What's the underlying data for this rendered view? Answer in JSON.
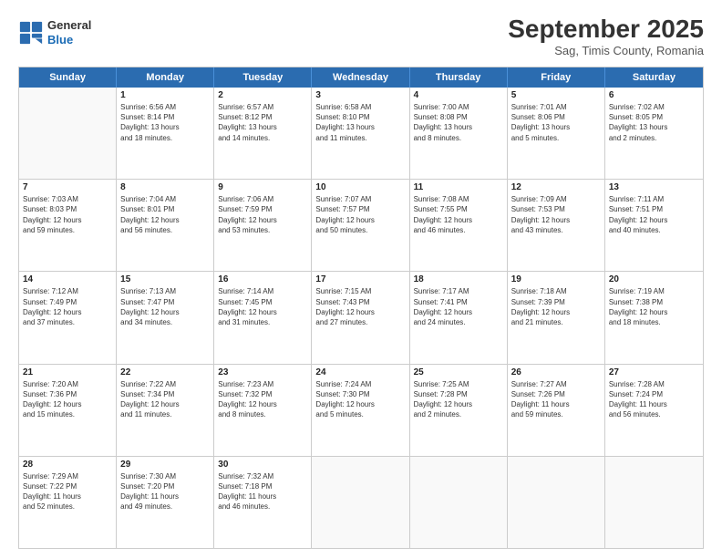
{
  "header": {
    "logo_general": "General",
    "logo_blue": "Blue",
    "month_title": "September 2025",
    "subtitle": "Sag, Timis County, Romania"
  },
  "days": [
    "Sunday",
    "Monday",
    "Tuesday",
    "Wednesday",
    "Thursday",
    "Friday",
    "Saturday"
  ],
  "rows": [
    [
      {
        "day": "",
        "info": ""
      },
      {
        "day": "1",
        "info": "Sunrise: 6:56 AM\nSunset: 8:14 PM\nDaylight: 13 hours\nand 18 minutes."
      },
      {
        "day": "2",
        "info": "Sunrise: 6:57 AM\nSunset: 8:12 PM\nDaylight: 13 hours\nand 14 minutes."
      },
      {
        "day": "3",
        "info": "Sunrise: 6:58 AM\nSunset: 8:10 PM\nDaylight: 13 hours\nand 11 minutes."
      },
      {
        "day": "4",
        "info": "Sunrise: 7:00 AM\nSunset: 8:08 PM\nDaylight: 13 hours\nand 8 minutes."
      },
      {
        "day": "5",
        "info": "Sunrise: 7:01 AM\nSunset: 8:06 PM\nDaylight: 13 hours\nand 5 minutes."
      },
      {
        "day": "6",
        "info": "Sunrise: 7:02 AM\nSunset: 8:05 PM\nDaylight: 13 hours\nand 2 minutes."
      }
    ],
    [
      {
        "day": "7",
        "info": "Sunrise: 7:03 AM\nSunset: 8:03 PM\nDaylight: 12 hours\nand 59 minutes."
      },
      {
        "day": "8",
        "info": "Sunrise: 7:04 AM\nSunset: 8:01 PM\nDaylight: 12 hours\nand 56 minutes."
      },
      {
        "day": "9",
        "info": "Sunrise: 7:06 AM\nSunset: 7:59 PM\nDaylight: 12 hours\nand 53 minutes."
      },
      {
        "day": "10",
        "info": "Sunrise: 7:07 AM\nSunset: 7:57 PM\nDaylight: 12 hours\nand 50 minutes."
      },
      {
        "day": "11",
        "info": "Sunrise: 7:08 AM\nSunset: 7:55 PM\nDaylight: 12 hours\nand 46 minutes."
      },
      {
        "day": "12",
        "info": "Sunrise: 7:09 AM\nSunset: 7:53 PM\nDaylight: 12 hours\nand 43 minutes."
      },
      {
        "day": "13",
        "info": "Sunrise: 7:11 AM\nSunset: 7:51 PM\nDaylight: 12 hours\nand 40 minutes."
      }
    ],
    [
      {
        "day": "14",
        "info": "Sunrise: 7:12 AM\nSunset: 7:49 PM\nDaylight: 12 hours\nand 37 minutes."
      },
      {
        "day": "15",
        "info": "Sunrise: 7:13 AM\nSunset: 7:47 PM\nDaylight: 12 hours\nand 34 minutes."
      },
      {
        "day": "16",
        "info": "Sunrise: 7:14 AM\nSunset: 7:45 PM\nDaylight: 12 hours\nand 31 minutes."
      },
      {
        "day": "17",
        "info": "Sunrise: 7:15 AM\nSunset: 7:43 PM\nDaylight: 12 hours\nand 27 minutes."
      },
      {
        "day": "18",
        "info": "Sunrise: 7:17 AM\nSunset: 7:41 PM\nDaylight: 12 hours\nand 24 minutes."
      },
      {
        "day": "19",
        "info": "Sunrise: 7:18 AM\nSunset: 7:39 PM\nDaylight: 12 hours\nand 21 minutes."
      },
      {
        "day": "20",
        "info": "Sunrise: 7:19 AM\nSunset: 7:38 PM\nDaylight: 12 hours\nand 18 minutes."
      }
    ],
    [
      {
        "day": "21",
        "info": "Sunrise: 7:20 AM\nSunset: 7:36 PM\nDaylight: 12 hours\nand 15 minutes."
      },
      {
        "day": "22",
        "info": "Sunrise: 7:22 AM\nSunset: 7:34 PM\nDaylight: 12 hours\nand 11 minutes."
      },
      {
        "day": "23",
        "info": "Sunrise: 7:23 AM\nSunset: 7:32 PM\nDaylight: 12 hours\nand 8 minutes."
      },
      {
        "day": "24",
        "info": "Sunrise: 7:24 AM\nSunset: 7:30 PM\nDaylight: 12 hours\nand 5 minutes."
      },
      {
        "day": "25",
        "info": "Sunrise: 7:25 AM\nSunset: 7:28 PM\nDaylight: 12 hours\nand 2 minutes."
      },
      {
        "day": "26",
        "info": "Sunrise: 7:27 AM\nSunset: 7:26 PM\nDaylight: 11 hours\nand 59 minutes."
      },
      {
        "day": "27",
        "info": "Sunrise: 7:28 AM\nSunset: 7:24 PM\nDaylight: 11 hours\nand 56 minutes."
      }
    ],
    [
      {
        "day": "28",
        "info": "Sunrise: 7:29 AM\nSunset: 7:22 PM\nDaylight: 11 hours\nand 52 minutes."
      },
      {
        "day": "29",
        "info": "Sunrise: 7:30 AM\nSunset: 7:20 PM\nDaylight: 11 hours\nand 49 minutes."
      },
      {
        "day": "30",
        "info": "Sunrise: 7:32 AM\nSunset: 7:18 PM\nDaylight: 11 hours\nand 46 minutes."
      },
      {
        "day": "",
        "info": ""
      },
      {
        "day": "",
        "info": ""
      },
      {
        "day": "",
        "info": ""
      },
      {
        "day": "",
        "info": ""
      }
    ]
  ]
}
